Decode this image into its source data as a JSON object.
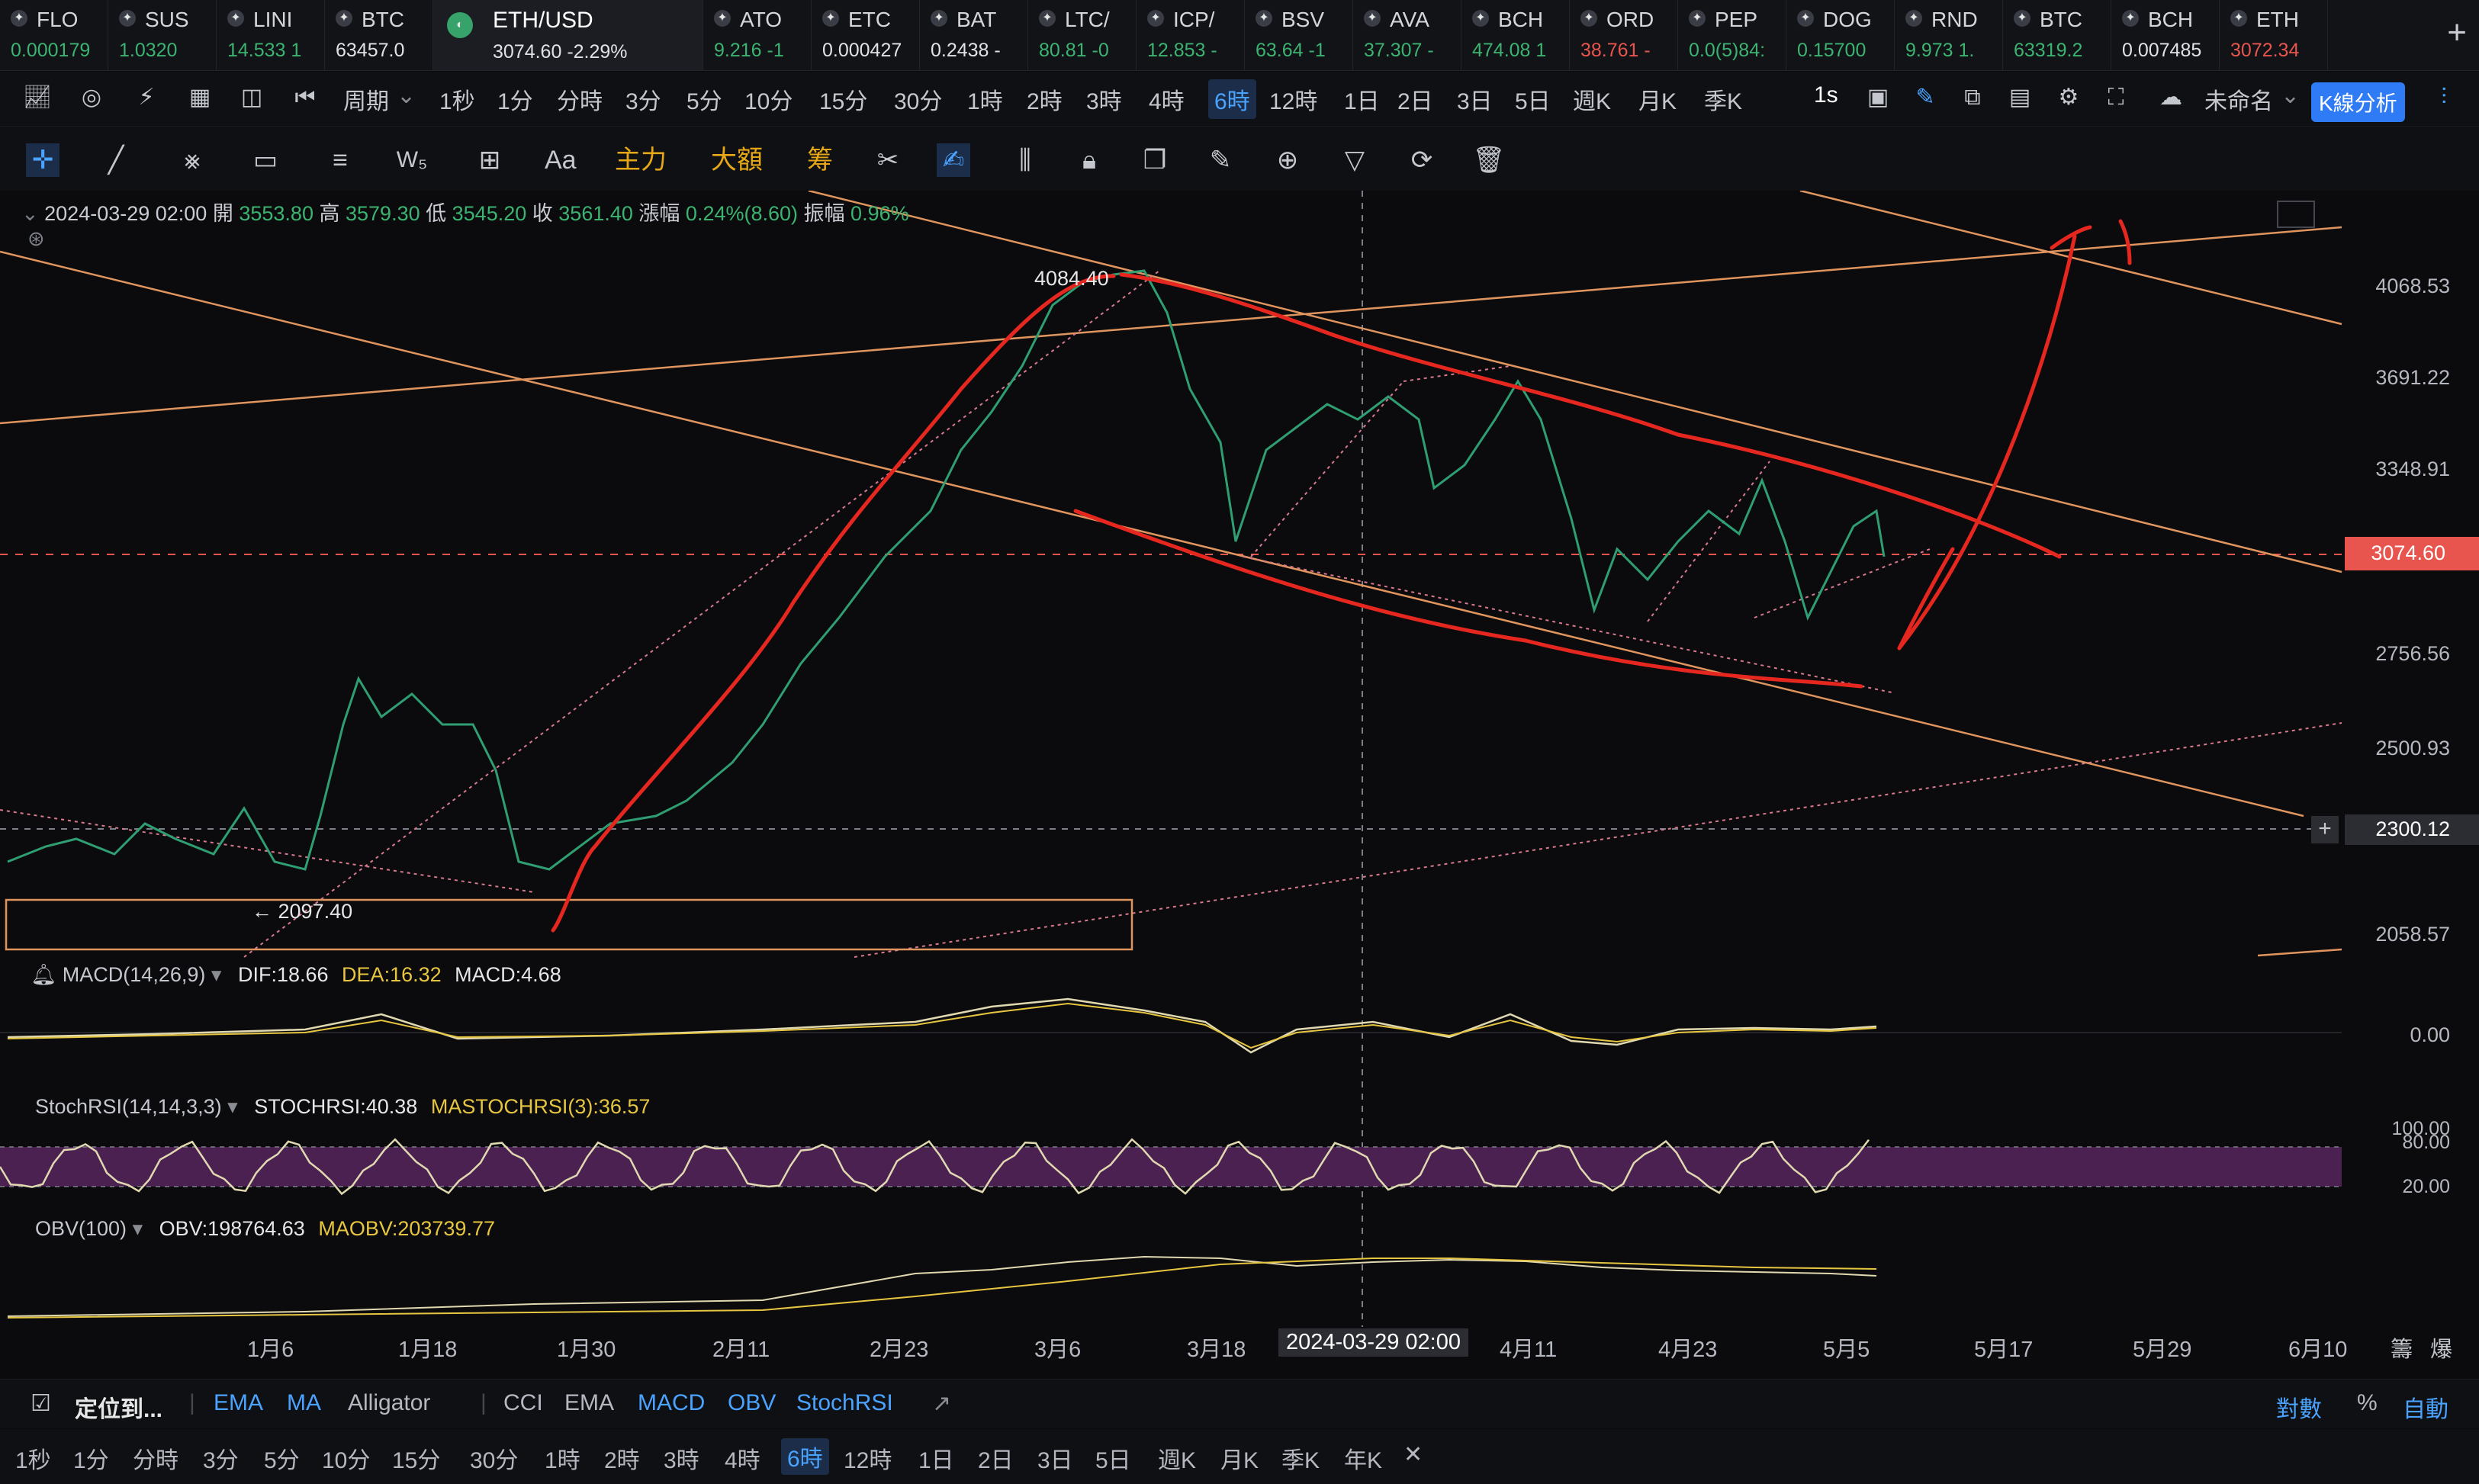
{
  "tickers": [
    {
      "sym": "FLO",
      "price": "0.000179",
      "color": "#3cb371"
    },
    {
      "sym": "SUS",
      "price": "1.0320",
      "color": "#3cb371"
    },
    {
      "sym": "LINI",
      "price": "14.533 1",
      "color": "#3cb371"
    },
    {
      "sym": "BTC",
      "price": "63457.0",
      "color": "#e0e2e6"
    },
    {
      "sym": "ETH/USD",
      "price": "3074.60 -2.29%",
      "color": "#e0e2e6",
      "active": true
    },
    {
      "sym": "ATO",
      "price": "9.216 -1",
      "color": "#3cb371"
    },
    {
      "sym": "ETC",
      "price": "0.000427",
      "color": "#e0e2e6"
    },
    {
      "sym": "BAT",
      "price": "0.2438 -",
      "color": "#e0e2e6"
    },
    {
      "sym": "LTC/",
      "price": "80.81 -0",
      "color": "#3cb371"
    },
    {
      "sym": "ICP/",
      "price": "12.853 -",
      "color": "#3cb371"
    },
    {
      "sym": "BSV",
      "price": "63.64 -1",
      "color": "#3cb371"
    },
    {
      "sym": "AVA",
      "price": "37.307 -",
      "color": "#3cb371"
    },
    {
      "sym": "BCH",
      "price": "474.08 1",
      "color": "#3cb371"
    },
    {
      "sym": "ORD",
      "price": "38.761 -",
      "color": "#e8554e"
    },
    {
      "sym": "PEP",
      "price": "0.0(5)84:",
      "color": "#3cb371"
    },
    {
      "sym": "DOG",
      "price": "0.15700",
      "color": "#3cb371"
    },
    {
      "sym": "RND",
      "price": "9.973 1.",
      "color": "#3cb371"
    },
    {
      "sym": "BTC",
      "price": "63319.2",
      "color": "#3cb371"
    },
    {
      "sym": "BCH",
      "price": "0.007485",
      "color": "#e0e2e6"
    },
    {
      "sym": "ETH",
      "price": "3072.34",
      "color": "#e8554e"
    }
  ],
  "period_bar": {
    "cycle_label": "周期",
    "periods": [
      "1秒",
      "1分",
      "分時",
      "3分",
      "5分",
      "10分",
      "15分",
      "30分",
      "1時",
      "2時",
      "3時",
      "4時",
      "6時",
      "12時",
      "1日",
      "2日",
      "3日",
      "5日",
      "週K",
      "月K",
      "季K"
    ],
    "selected": "6時",
    "interval": "1s",
    "layout_name": "未命名",
    "kline_btn": "K線分析"
  },
  "draw_bar": {
    "text_tools": [
      "Aa",
      "主力",
      "大額",
      "筹"
    ]
  },
  "info": {
    "date": "2024-03-29 02:00",
    "open_label": "開",
    "open": "3553.80",
    "high_label": "高",
    "high": "3579.30",
    "low_label": "低",
    "low": "3545.20",
    "close_label": "收",
    "close": "3561.40",
    "change_label": "漲幅",
    "change": "0.24%(8.60)",
    "amp_label": "振幅",
    "amp": "0.96%"
  },
  "chart_data": {
    "type": "line",
    "annotations": {
      "high": "4084.40",
      "low": "← 2097.40"
    },
    "y_ticks": [
      "4068.53",
      "3691.22",
      "3348.91",
      "3074.60",
      "2756.56",
      "2500.93",
      "2300.12",
      "2058.57"
    ],
    "current_price": "3074.60",
    "crosshair_price": "2300.12",
    "x_ticks": [
      "1月6",
      "1月18",
      "1月30",
      "2月11",
      "2月23",
      "3月6",
      "3月18",
      "2024-03-29 02:00",
      "4月11",
      "4月23",
      "5月5",
      "5月17",
      "5月29",
      "6月10"
    ],
    "close_path_description_values": [
      2250,
      2350,
      2300,
      2450,
      2600,
      2500,
      2350,
      2200,
      2300,
      2450,
      2700,
      2900,
      3200,
      3500,
      3800,
      4084,
      3700,
      3250,
      3600,
      3500,
      3700,
      3300,
      3700,
      2900,
      3200,
      3300,
      2850,
      3250,
      3074
    ]
  },
  "macd": {
    "label": "MACD(14,26,9)",
    "dif": "DIF:18.66",
    "dea": "DEA:16.32",
    "macd": "MACD:4.68",
    "zero": "0.00"
  },
  "stochrsi": {
    "label": "StochRSI(14,14,3,3)",
    "k": "STOCHRSI:40.38",
    "d": "MASTOCHRSI(3):36.57",
    "t100": "100.00",
    "t80": "80.00",
    "t20": "20.00"
  },
  "obv": {
    "label": "OBV(100)",
    "obv": "OBV:198764.63",
    "ma": "MAOBV:203739.77"
  },
  "axis_end": [
    "籌",
    "爆"
  ],
  "indicator_bar": {
    "locate": "定位到...",
    "main": [
      "EMA",
      "MA",
      "Alligator"
    ],
    "sub": [
      "CCI",
      "EMA",
      "MACD",
      "OBV",
      "StochRSI"
    ],
    "right": [
      "對數",
      "%",
      "自動"
    ]
  },
  "bottom_periods": [
    "1秒",
    "1分",
    "分時",
    "3分",
    "5分",
    "10分",
    "15分",
    "30分",
    "1時",
    "2時",
    "3時",
    "4時",
    "6時",
    "12時",
    "1日",
    "2日",
    "3日",
    "5日",
    "週K",
    "月K",
    "季K",
    "年K"
  ],
  "bottom_selected": "6時"
}
